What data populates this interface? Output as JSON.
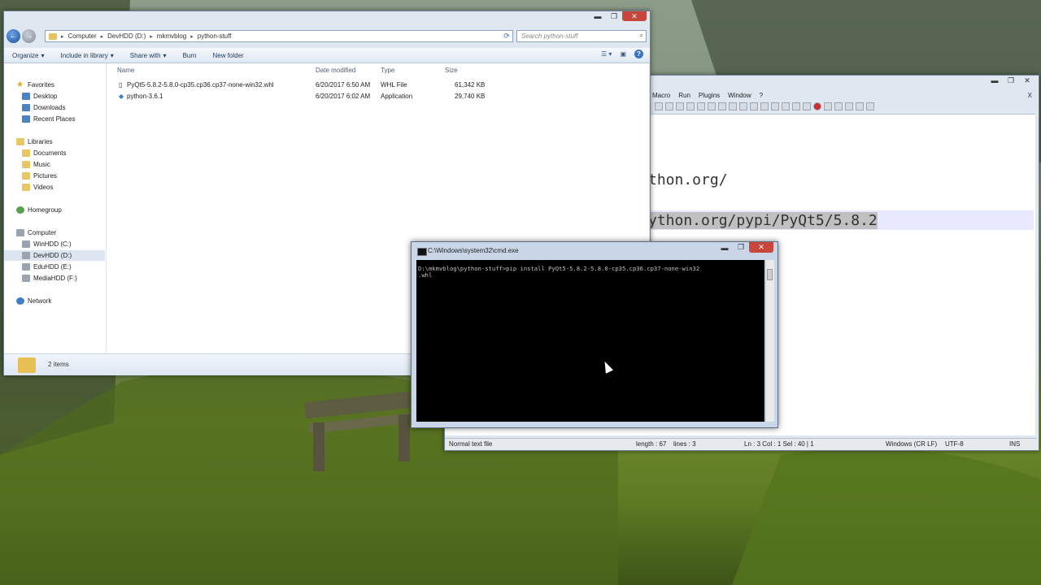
{
  "explorer": {
    "breadcrumb": [
      "Computer",
      "DevHDD (D:)",
      "mkmvblog",
      "python-stuff"
    ],
    "search_placeholder": "Search python-stuff",
    "toolbar": [
      "Organize",
      "Include in library",
      "Share with",
      "Burn",
      "New folder"
    ],
    "nav": {
      "favorites": "Favorites",
      "favorites_items": [
        "Desktop",
        "Downloads",
        "Recent Places"
      ],
      "libraries": "Libraries",
      "libraries_items": [
        "Documents",
        "Music",
        "Pictures",
        "Videos"
      ],
      "homegroup": "Homegroup",
      "computer": "Computer",
      "computer_items": [
        "WinHDD (C:)",
        "DevHDD (D:)",
        "EduHDD (E:)",
        "MediaHDD (F:)"
      ],
      "network": "Network"
    },
    "columns": [
      "Name",
      "Date modified",
      "Type",
      "Size"
    ],
    "files": [
      {
        "name": "PyQt5-5.8.2-5.8.0-cp35.cp36.cp37-none-win32.whl",
        "date": "6/20/2017 6:50 AM",
        "type": "WHL File",
        "size": "61,342 KB"
      },
      {
        "name": "python-3.6.1",
        "date": "6/20/2017 6:02 AM",
        "type": "Application",
        "size": "29,740 KB"
      }
    ],
    "status": "2 items"
  },
  "npp": {
    "menu": [
      "Macro",
      "Run",
      "Plugins",
      "Window",
      "?"
    ],
    "menu_close": "X",
    "lines": [
      "thon.org/",
      "ython.org/pypi/PyQt5/5.8.2"
    ],
    "status": {
      "type": "Normal text file",
      "length": "length : 67",
      "lines": "lines : 3",
      "pos": "Ln : 3    Col : 1    Sel : 40 | 1",
      "eol": "Windows (CR LF)",
      "encoding": "UTF-8",
      "mode": "INS"
    }
  },
  "cmd": {
    "title": "C:\\Windows\\system32\\cmd.exe",
    "output": "D:\\mkmvblog\\python-stuff>pip install PyQt5-5.8.2-5.8.0-cp35.cp36.cp37-none-win32\n.whl"
  },
  "colors": {
    "accent": "#3b73c2",
    "close_button": "#c9463d",
    "console_bg": "#000000",
    "console_fg": "#c0c0c0"
  }
}
